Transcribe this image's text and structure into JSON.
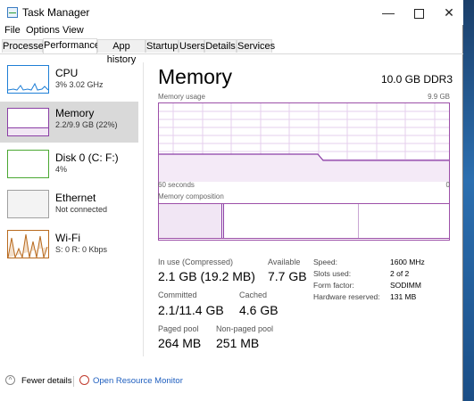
{
  "window": {
    "title": "Task Manager"
  },
  "menu": [
    "File",
    "Options",
    "View"
  ],
  "tabs": [
    {
      "label": "Processes",
      "active": false
    },
    {
      "label": "Performance",
      "active": true
    },
    {
      "label": "App history",
      "active": false
    },
    {
      "label": "Startup",
      "active": false
    },
    {
      "label": "Users",
      "active": false
    },
    {
      "label": "Details",
      "active": false
    },
    {
      "label": "Services",
      "active": false
    }
  ],
  "sidebar": {
    "items": [
      {
        "name": "CPU",
        "sub": "3% 3.02 GHz",
        "color": "#1f7fd6",
        "selected": false
      },
      {
        "name": "Memory",
        "sub": "2.2/9.9 GB (22%)",
        "color": "#8b3fa6",
        "selected": true
      },
      {
        "name": "Disk 0 (C: F:)",
        "sub": "4%",
        "color": "#4aa832",
        "selected": false
      },
      {
        "name": "Ethernet",
        "sub": "Not connected",
        "color": "#a0a0a0",
        "selected": false
      },
      {
        "name": "Wi-Fi",
        "sub": "S: 0 R: 0 Kbps",
        "color": "#b86a1f",
        "selected": false
      }
    ]
  },
  "main": {
    "title": "Memory",
    "spec": "10.0 GB DDR3",
    "usage_label": "Memory usage",
    "usage_max": "9.9 GB",
    "time_left": "60 seconds",
    "time_right": "0",
    "composition_label": "Memory composition",
    "usage_fraction": 0.22
  },
  "stats": {
    "in_use_label": "In use (Compressed)",
    "in_use_value": "2.1 GB (19.2 MB)",
    "available_label": "Available",
    "available_value": "7.7 GB",
    "committed_label": "Committed",
    "committed_value": "2.1/11.4 GB",
    "cached_label": "Cached",
    "cached_value": "4.6 GB",
    "paged_label": "Paged pool",
    "paged_value": "264 MB",
    "nonpaged_label": "Non-paged pool",
    "nonpaged_value": "251 MB"
  },
  "properties": [
    {
      "label": "Speed:",
      "value": "1600 MHz"
    },
    {
      "label": "Slots used:",
      "value": "2 of 2"
    },
    {
      "label": "Form factor:",
      "value": "SODIMM"
    },
    {
      "label": "Hardware reserved:",
      "value": "131 MB"
    }
  ],
  "footer": {
    "fewer_details": "Fewer details",
    "open_monitor": "Open Resource Monitor"
  },
  "colors": {
    "memory_accent": "#8b3fa6",
    "link": "#1f5fbf"
  }
}
